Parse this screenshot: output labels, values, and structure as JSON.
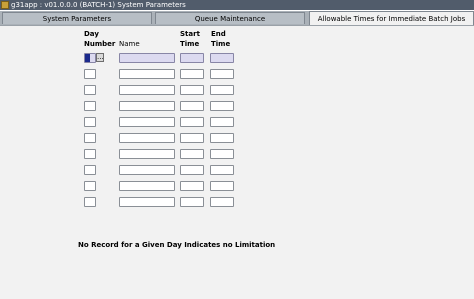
{
  "window": {
    "title": "g31app : v01.0.0.0 (BATCH-1) System Parameters",
    "app_icon": "oracle-forms-icon"
  },
  "tabs": [
    {
      "label": "System Parameters",
      "active": false
    },
    {
      "label": "Queue Maintenance",
      "active": false
    },
    {
      "label": "Allowable Times for Immediate Batch Jobs",
      "active": true
    }
  ],
  "columns": {
    "day_number": {
      "line1": "Day",
      "line2": "Number"
    },
    "name": "Name",
    "start_time": {
      "line1": "Start",
      "line2": "Time"
    },
    "end_time": {
      "line1": "End",
      "line2": "Time"
    }
  },
  "rows": [
    {
      "day_number": "",
      "name": "",
      "start_time": "",
      "end_time": "",
      "current": true
    },
    {
      "day_number": "",
      "name": "",
      "start_time": "",
      "end_time": ""
    },
    {
      "day_number": "",
      "name": "",
      "start_time": "",
      "end_time": ""
    },
    {
      "day_number": "",
      "name": "",
      "start_time": "",
      "end_time": ""
    },
    {
      "day_number": "",
      "name": "",
      "start_time": "",
      "end_time": ""
    },
    {
      "day_number": "",
      "name": "",
      "start_time": "",
      "end_time": ""
    },
    {
      "day_number": "",
      "name": "",
      "start_time": "",
      "end_time": ""
    },
    {
      "day_number": "",
      "name": "",
      "start_time": "",
      "end_time": ""
    },
    {
      "day_number": "",
      "name": "",
      "start_time": "",
      "end_time": ""
    },
    {
      "day_number": "",
      "name": "",
      "start_time": "",
      "end_time": ""
    }
  ],
  "lov_button_label": "...",
  "footer_note": "No Record for a Given Day Indicates no Limitation",
  "colors": {
    "title_bar": "#515c6b",
    "required_field": "#dcdaf0",
    "cursor": "#1b2a8c"
  }
}
